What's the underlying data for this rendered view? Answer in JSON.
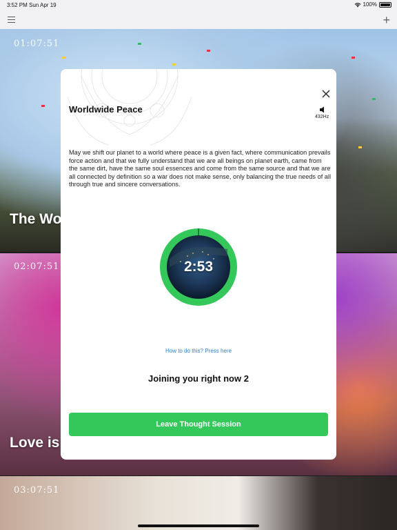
{
  "status_bar": {
    "time": "3:52 PM",
    "date": "Sun Apr 19",
    "battery": "100%"
  },
  "nav": {
    "menu_icon": "hamburger-icon",
    "add_icon": "plus-icon"
  },
  "background_cards": [
    {
      "time": "01:07:51",
      "title": "The Wo"
    },
    {
      "time": "02:07:51",
      "title": "Love is"
    },
    {
      "time": "03:07:51"
    }
  ],
  "modal": {
    "title": "Worldwide Peace",
    "frequency": "432Hz",
    "description": "May we shift our planet to a world where peace is a given fact, where communication prevails force action and that we fully understand that we are all beings on planet earth, came from the same dirt, have the same soul essences and come from the same source and that we are all connected by definition so a war does not make sense, only balancing the true needs of all through true and sincere conversations.",
    "timer": "2:53",
    "help_link": "How to do this? Press here",
    "joining": "Joining you right now 2",
    "leave_button": "Leave Thought Session",
    "accent_color": "#34c85a",
    "link_color": "#2a7fd4"
  }
}
